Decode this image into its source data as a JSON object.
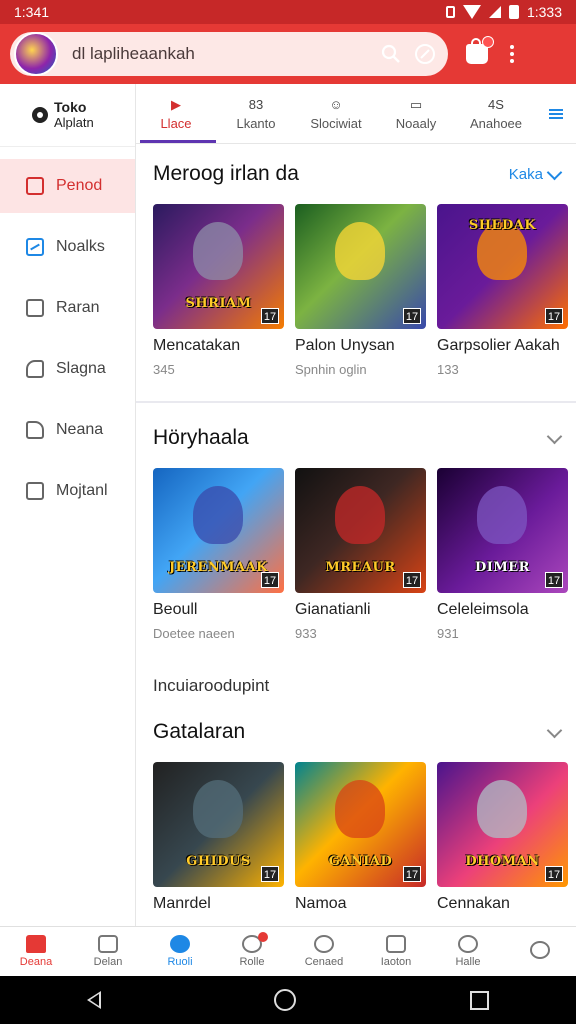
{
  "status": {
    "time": "1:341",
    "time_right": "1:333"
  },
  "search": {
    "text": "dl lapliheaankah"
  },
  "brand": {
    "line1": "Toko",
    "line2": "Alplatn"
  },
  "sidebar": {
    "items": [
      {
        "label": "Penod"
      },
      {
        "label": "Noalks"
      },
      {
        "label": "Raran"
      },
      {
        "label": "Slagna"
      },
      {
        "label": "Neana"
      },
      {
        "label": "Mojtanl"
      }
    ]
  },
  "tabs": [
    {
      "label": "Llace",
      "icon_text": "▶"
    },
    {
      "label": "Lkanto",
      "icon_text": "83"
    },
    {
      "label": "Slociwiat",
      "icon_text": "☺"
    },
    {
      "label": "Noaaly",
      "icon_text": "▭"
    },
    {
      "label": "Anahoee",
      "icon_text": "4S"
    }
  ],
  "sections": [
    {
      "title": "Meroog irlan da",
      "action": "Kaka",
      "cards": [
        {
          "title": "Mencatakan",
          "sub": "345",
          "art": "SHRIAM",
          "badge": "17"
        },
        {
          "title": "Palon Unysan",
          "sub": "Spnhin oglin",
          "art": "",
          "badge": "17"
        },
        {
          "title": "Garpsolier Aakah",
          "sub": "133",
          "art": "SHEDAK",
          "badge": "17"
        }
      ]
    },
    {
      "title": "Höryhaala",
      "cards": [
        {
          "title": "Beoull",
          "sub": "Doetee naeen",
          "art": "JERENMAAK",
          "badge": "17"
        },
        {
          "title": "Gianatianli",
          "sub": "933",
          "art": "MREAUR",
          "badge": "17"
        },
        {
          "title": "Celeleimsola",
          "sub": "931",
          "art": "DIMER",
          "badge": "17"
        }
      ]
    },
    {
      "label": "Incuiaroodupint",
      "title": "Gatalaran",
      "cards": [
        {
          "title": "Manrdel",
          "sub": "",
          "art": "GHIDUS",
          "badge": "17"
        },
        {
          "title": "Namoa",
          "sub": "",
          "art": "GANIAD",
          "badge": "17"
        },
        {
          "title": "Cennakan",
          "sub": "",
          "art": "DHOMAN",
          "badge": "17"
        }
      ]
    }
  ],
  "bottomnav": [
    {
      "label": "Deana"
    },
    {
      "label": "Delan"
    },
    {
      "label": "Ruoli"
    },
    {
      "label": "Rolle"
    },
    {
      "label": "Cenaed"
    },
    {
      "label": "Iaoton"
    },
    {
      "label": "Halle"
    },
    {
      "label": ""
    }
  ]
}
